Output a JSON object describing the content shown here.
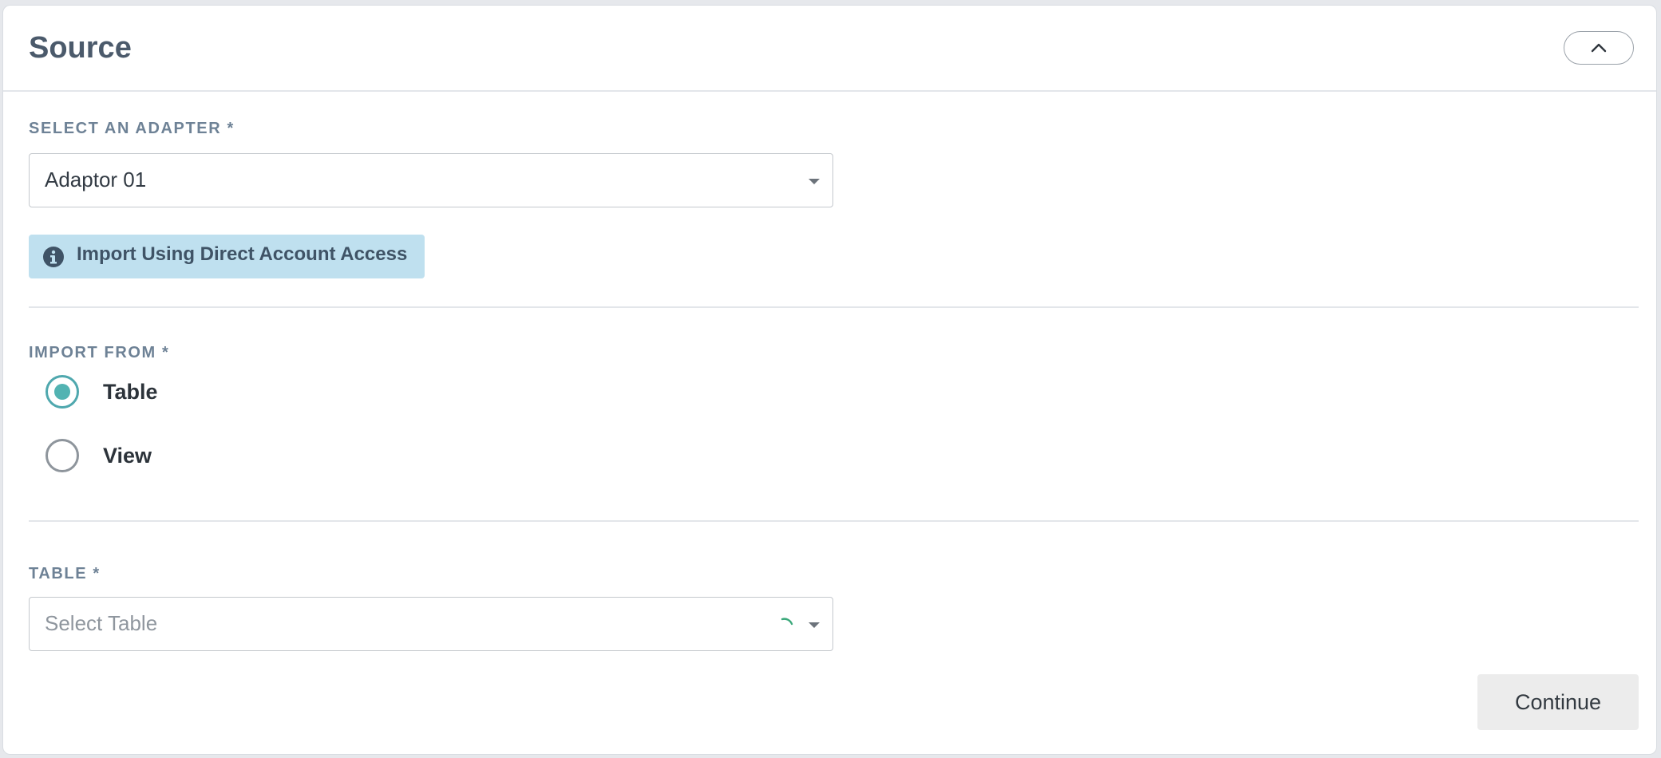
{
  "card": {
    "title": "Source"
  },
  "adapter": {
    "label": "SELECT AN ADAPTER *",
    "value": "Adaptor 01"
  },
  "info": {
    "text": "Import Using Direct Account Access"
  },
  "import_from": {
    "label": "IMPORT FROM *",
    "options": [
      {
        "label": "Table",
        "selected": true
      },
      {
        "label": "View",
        "selected": false
      }
    ]
  },
  "table": {
    "label": "TABLE *",
    "placeholder": "Select Table"
  },
  "actions": {
    "continue_label": "Continue"
  },
  "colors": {
    "accent": "#52b3b2",
    "info_bg": "#bfe0ef",
    "title": "#4b5a6b",
    "label": "#6e8296"
  },
  "icons": {
    "collapse": "chevron-up-icon",
    "info": "info-circle-icon",
    "dropdown": "caret-down-icon",
    "loading": "spinner-icon"
  }
}
